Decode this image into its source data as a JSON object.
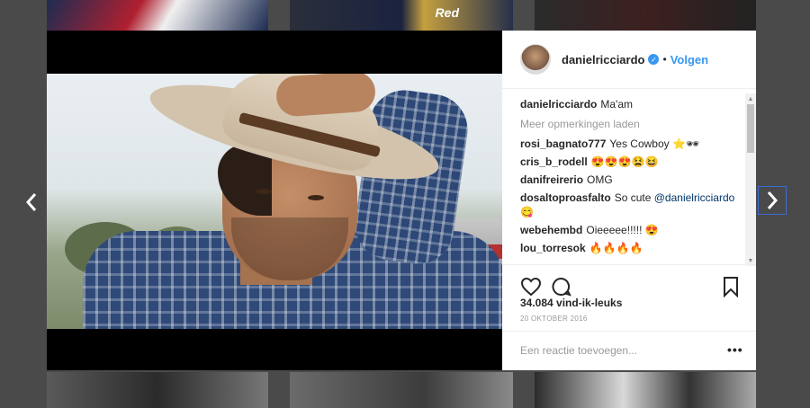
{
  "background": {
    "thumb_text": "Red"
  },
  "nav": {
    "prev_icon": "chevron-left-icon",
    "next_icon": "chevron-right-icon"
  },
  "post": {
    "username": "danielricciardo",
    "verified_icon": "verified-badge-icon",
    "separator": "•",
    "follow_label": "Volgen",
    "caption_user": "danielricciardo",
    "caption_text": "Ma'am",
    "load_more": "Meer opmerkingen laden",
    "comments": [
      {
        "user": "rosi_bagnato777",
        "text": "Yes Cowboy ⭐🕶"
      },
      {
        "user": "cris_b_rodell",
        "text": "😍😍😍😫😆"
      },
      {
        "user": "danifreirerio",
        "text": "OMG"
      },
      {
        "user": "dosaltoproasfalto",
        "text": "So cute",
        "mention": "@danielricciardo",
        "extra": "😋"
      },
      {
        "user": "webehembd",
        "text": "Oieeeee!!!!! 😍"
      },
      {
        "user": "lou_torresok",
        "text": "🔥🔥🔥🔥"
      }
    ],
    "likes": "34.084 vind-ik-leuks",
    "date": "20 OKTOBER 2016",
    "add_comment_placeholder": "Een reactie toevoegen...",
    "more_options": "•••"
  },
  "colors": {
    "accent": "#3897f0",
    "backdrop": "#4a4a4a",
    "nav_focus": "#3b6dd6"
  }
}
